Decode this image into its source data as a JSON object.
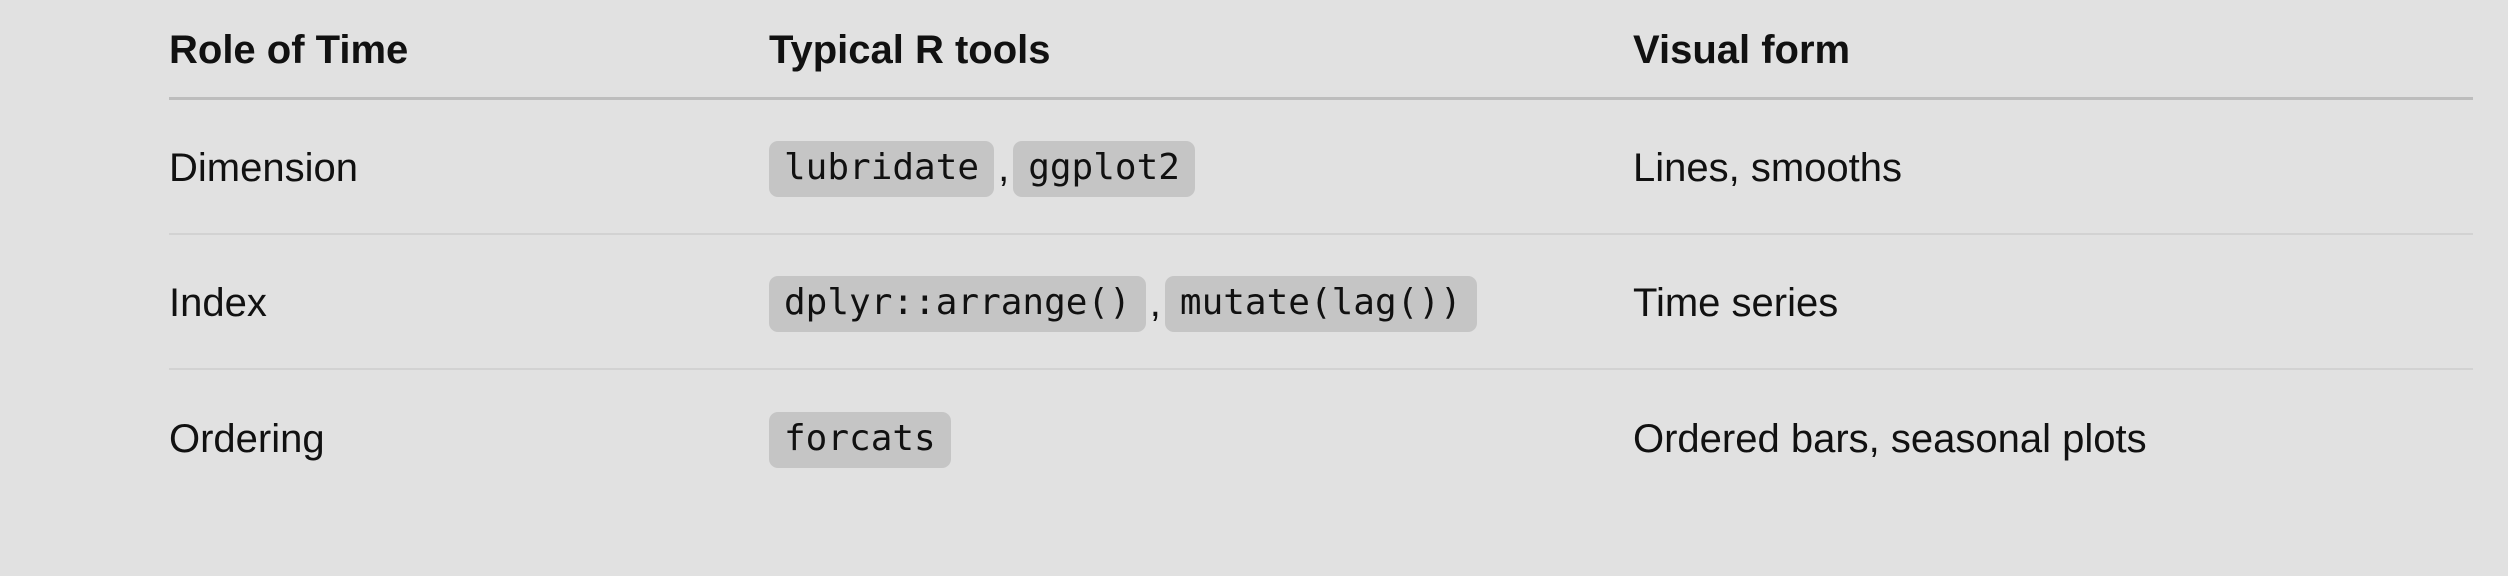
{
  "table": {
    "headers": [
      "Role of Time",
      "Typical R tools",
      "Visual form"
    ],
    "rows": [
      {
        "role": "Dimension",
        "tools": [
          "lubridate",
          "ggplot2"
        ],
        "visual": "Lines, smooths"
      },
      {
        "role": "Index",
        "tools": [
          "dplyr::arrange()",
          "mutate(lag())"
        ],
        "visual": "Time series"
      },
      {
        "role": "Ordering",
        "tools": [
          "forcats"
        ],
        "visual": "Ordered bars, seasonal plots"
      }
    ],
    "separator": ","
  }
}
